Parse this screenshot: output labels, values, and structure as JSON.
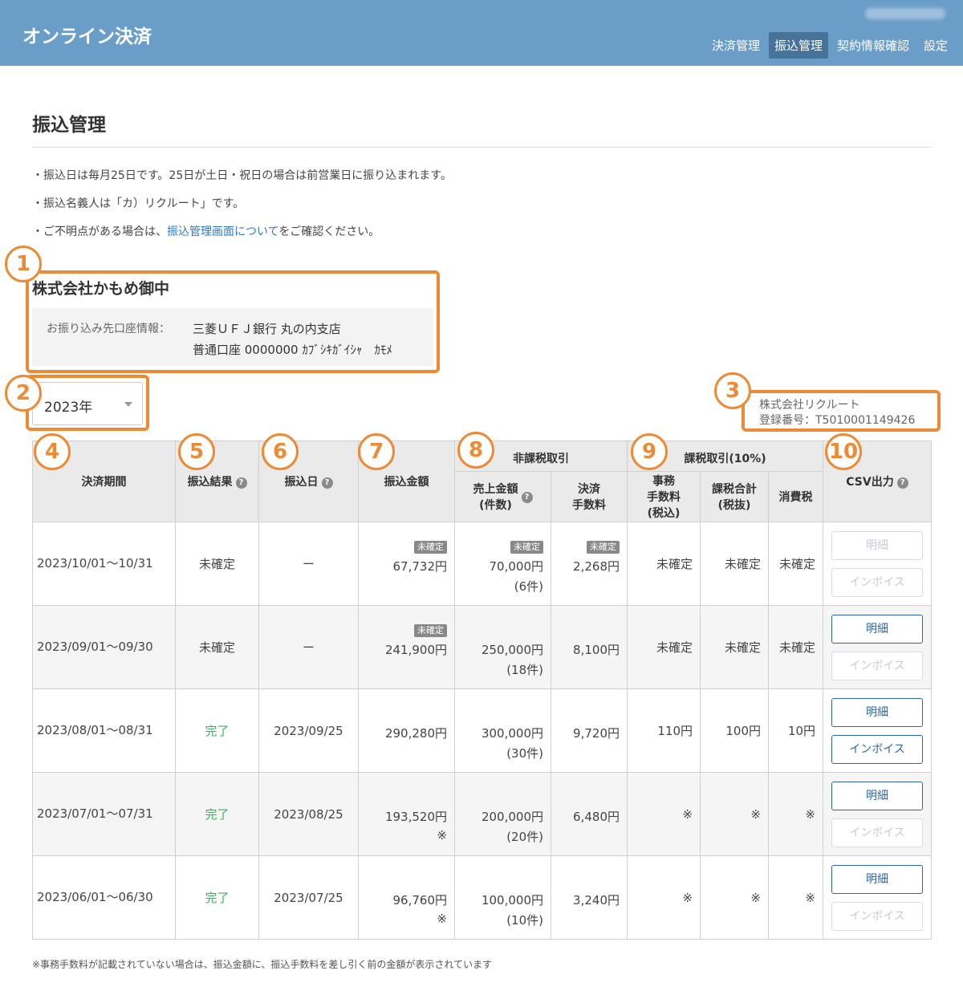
{
  "header": {
    "app_title": "オンライン決済",
    "user_name": "",
    "nav": [
      "決済管理",
      "振込管理",
      "契約情報確認",
      "設定"
    ],
    "active_nav": "振込管理"
  },
  "page": {
    "title": "振込管理",
    "notes": {
      "line1": "・振込日は毎月25日です。25日が土日・祝日の場合は前営業日に振り込まれます。",
      "line2": "・振込名義人は「カ）リクルート」です。",
      "line3_prefix": "・ご不明点がある場合は、",
      "line3_link": "振込管理画面について",
      "line3_suffix": "をご確認ください。"
    }
  },
  "company": {
    "name": "株式会社かもめ御中",
    "account_label": "お振り込み先口座情報：",
    "account_line1": "三菱ＵＦＪ銀行 丸の内支店",
    "account_line2": "普通口座 0000000 ｶﾌﾞｼｷｶﾞｲｼｬ　ｶﾓﾒ"
  },
  "year_select": {
    "value": "2023年"
  },
  "recruit": {
    "name": "株式会社リクルート",
    "registration": "登録番号：T5010001149426"
  },
  "callouts": [
    "1",
    "2",
    "3",
    "4",
    "5",
    "6",
    "7",
    "8",
    "9",
    "10"
  ],
  "table": {
    "headers": {
      "period": "決済期間",
      "result": "振込結果",
      "date": "振込日",
      "amount": "振込金額",
      "nontax_group": "非課税取引",
      "sales": "売上金額",
      "sales_count": "(件数)",
      "fee": "決済",
      "fee2": "手数料",
      "tax_group": "課税取引(10%)",
      "office_fee1": "事務",
      "office_fee2": "手数料",
      "office_fee3": "(税込)",
      "tax_total1": "課税合計",
      "tax_total2": "(税抜)",
      "consumption_tax": "消費税",
      "csv": "CSV出力",
      "help": "?"
    },
    "pending_tag": "未確定",
    "detail_button": "明細",
    "invoice_button": "インボイス",
    "rows": [
      {
        "period": "2023/10/01〜10/31",
        "result": "未確定",
        "date": "ー",
        "amount": "67,732円",
        "amount_note": "",
        "sales": "70,000円",
        "sales_count": "(6件)",
        "fee": "2,268円",
        "office_fee": "未確定",
        "tax_total": "未確定",
        "tax": "未確定"
      },
      {
        "period": "2023/09/01〜09/30",
        "result": "未確定",
        "date": "ー",
        "amount": "241,900円",
        "amount_note": "",
        "sales": "250,000円",
        "sales_count": "(18件)",
        "fee": "8,100円",
        "office_fee": "未確定",
        "tax_total": "未確定",
        "tax": "未確定"
      },
      {
        "period": "2023/08/01〜08/31",
        "result": "完了",
        "date": "2023/09/25",
        "amount": "290,280円",
        "amount_note": "",
        "sales": "300,000円",
        "sales_count": "(30件)",
        "fee": "9,720円",
        "office_fee": "110円",
        "tax_total": "100円",
        "tax": "10円"
      },
      {
        "period": "2023/07/01〜07/31",
        "result": "完了",
        "date": "2023/08/25",
        "amount": "193,520円",
        "amount_note": "※",
        "sales": "200,000円",
        "sales_count": "(20件)",
        "fee": "6,480円",
        "office_fee": "※",
        "tax_total": "※",
        "tax": "※"
      },
      {
        "period": "2023/06/01〜06/30",
        "result": "完了",
        "date": "2023/07/25",
        "amount": "96,760円",
        "amount_note": "※",
        "sales": "100,000円",
        "sales_count": "(10件)",
        "fee": "3,240円",
        "office_fee": "※",
        "tax_total": "※",
        "tax": "※"
      }
    ]
  },
  "footnote": "※事務手数料が記載されていない場合は、振込金額に、振込手数料を差し引く前の金額が表示されています",
  "colors": {
    "header_bg": "#6a9ec9",
    "nav_active": "#47739a",
    "accent_orange": "#ee8a34",
    "link": "#2f78c4",
    "done": "#3fae5c",
    "button": "#2e64ab"
  }
}
